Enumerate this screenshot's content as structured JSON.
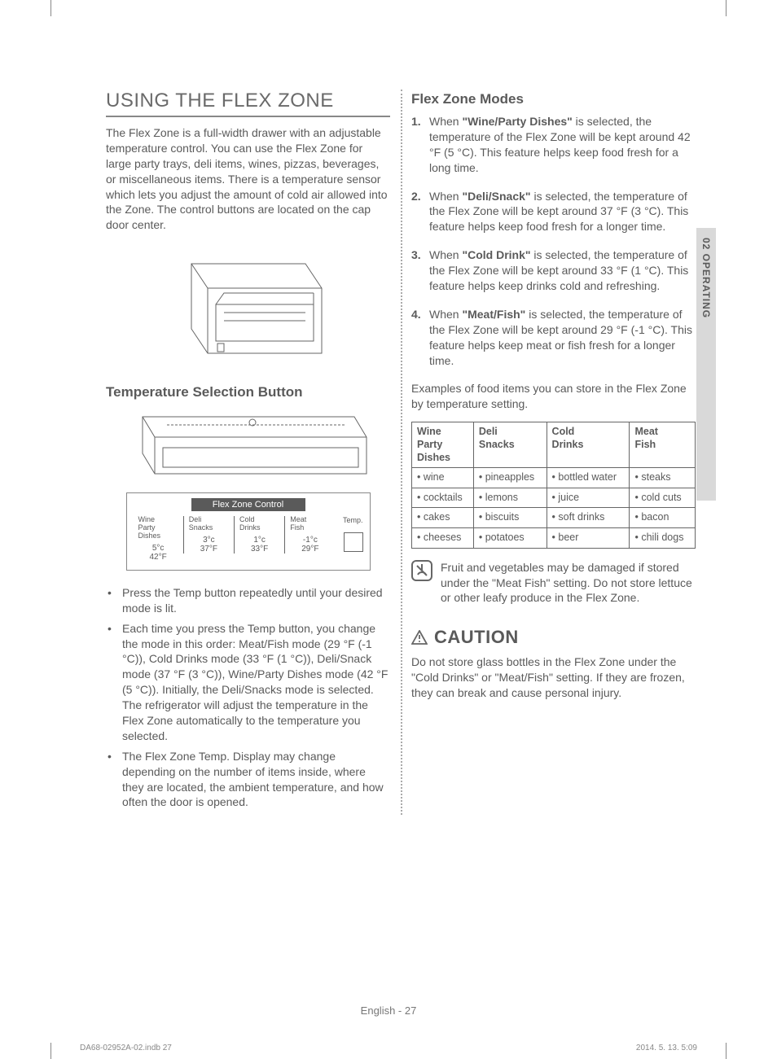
{
  "sideTab": "02  OPERATING",
  "heading": "USING THE FLEX ZONE",
  "intro": "The Flex Zone is a full-width drawer with an adjustable temperature control. You can use the Flex Zone for large party trays, deli items, wines, pizzas, beverages, or miscellaneous items. There is a temperature sensor which lets you adjust the amount of cold air allowed into the Zone. The control buttons are located on the cap door center.",
  "subheading1": "Temperature Selection Button",
  "controlTitle": "Flex Zone Control",
  "controls": [
    {
      "label": "Wine\nParty\nDishes",
      "c": "5°c",
      "f": "42°F"
    },
    {
      "label": "Deli\nSnacks",
      "c": "3°c",
      "f": "37°F"
    },
    {
      "label": "Cold\nDrinks",
      "c": "1°c",
      "f": "33°F"
    },
    {
      "label": "Meat\nFish",
      "c": "-1°c",
      "f": "29°F"
    }
  ],
  "tempLabel": "Temp.",
  "bullets": [
    "Press the Temp button repeatedly until your desired mode is lit.",
    "Each time you press the Temp button, you change the mode in this order: Meat/Fish mode (29 °F (-1 °C)), Cold Drinks mode (33 °F (1 °C)), Deli/Snack mode (37 °F (3 °C)), Wine/Party Dishes mode (42 °F (5 °C)). Initially, the Deli/Snacks mode is selected. The refrigerator will adjust the temperature in the Flex Zone automatically to the temperature you selected.",
    "The Flex Zone Temp. Display may change depending on the number of items inside, where they are located, the ambient temperature, and how often the door is opened."
  ],
  "modesHeading": "Flex Zone Modes",
  "modes": [
    {
      "num": "1.",
      "bold": "\"Wine/Party Dishes\"",
      "pre": "When ",
      "post": " is selected, the temperature of the Flex Zone will be kept around 42 °F (5 °C). This feature helps keep food fresh for a long time."
    },
    {
      "num": "2.",
      "bold": "\"Deli/Snack\"",
      "pre": "When ",
      "post": " is selected, the temperature of the Flex Zone will be kept around 37 °F (3 °C). This feature helps keep food fresh for a longer time."
    },
    {
      "num": "3.",
      "bold": "\"Cold Drink\"",
      "pre": "When ",
      "post": " is selected, the temperature of the Flex Zone will be kept around 33 °F (1 °C). This feature helps keep drinks cold and refreshing."
    },
    {
      "num": "4.",
      "bold": "\"Meat/Fish\"",
      "pre": "When ",
      "post": " is selected, the temperature of the Flex Zone will be kept around 29 °F (-1 °C). This feature helps keep meat or fish fresh for a longer time."
    }
  ],
  "exampleIntro": "Examples of food items you can store in the Flex Zone by temperature setting.",
  "tableHeaders": [
    "Wine Party Dishes",
    "Deli Snacks",
    "Cold Drinks",
    "Meat Fish"
  ],
  "tableRows": [
    [
      "wine",
      "pineapples",
      "bottled water",
      "steaks"
    ],
    [
      "cocktails",
      "lemons",
      "juice",
      "cold cuts"
    ],
    [
      "cakes",
      "biscuits",
      "soft drinks",
      "bacon"
    ],
    [
      "cheeses",
      "potatoes",
      "beer",
      "chili dogs"
    ]
  ],
  "noteText": "Fruit and vegetables may be damaged if stored under the \"Meat Fish\" setting. Do not store lettuce or other leafy produce in the Flex Zone.",
  "cautionLabel": "CAUTION",
  "cautionText": "Do not store glass bottles in the Flex Zone under the \"Cold Drinks\" or \"Meat/Fish\" setting. If they are frozen, they can break and cause personal injury.",
  "footer": "English - 27",
  "indb": "DA68-02952A-02.indb   27",
  "datetime": "2014. 5. 13.     5:09"
}
